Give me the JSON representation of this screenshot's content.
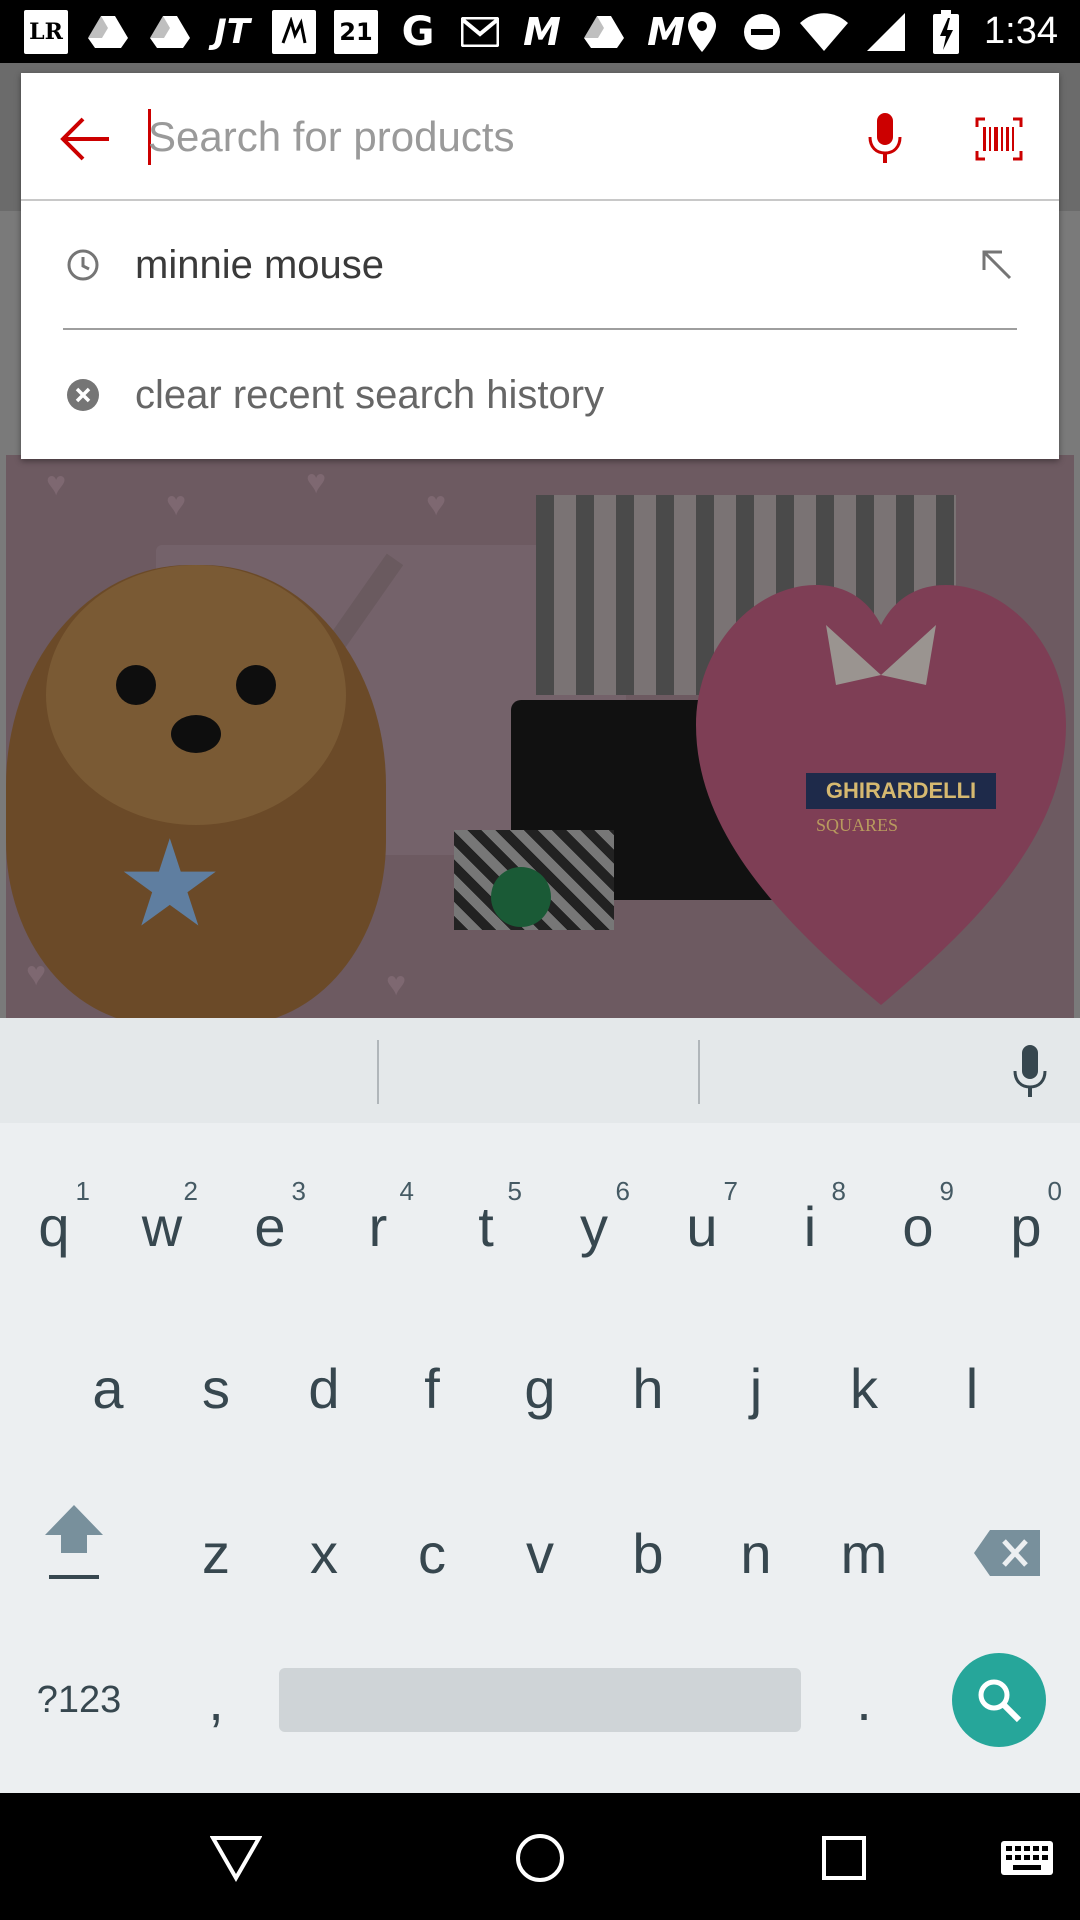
{
  "status_bar": {
    "time": "1:34",
    "icons": [
      "lr-app-icon",
      "drive-icon",
      "drive-icon",
      "jt-app-icon",
      "ny-app-icon",
      "forever21-icon",
      "google-icon",
      "gmail-icon",
      "m-app-icon",
      "drive-icon",
      "m-app-icon",
      "location-icon",
      "do-not-disturb-icon",
      "wifi-icon",
      "signal-icon",
      "battery-charging-icon"
    ],
    "lr_label": "LR",
    "jt_label": "JT",
    "f21_label": "21",
    "g_label": "G",
    "m_label": "M"
  },
  "search": {
    "placeholder": "Search for products",
    "value": "",
    "accent_color": "#cc0000"
  },
  "suggestions": {
    "recent": [
      {
        "label": "minnie mouse",
        "icon": "history-icon",
        "action_icon": "fill-query-arrow-icon"
      }
    ],
    "clear_label": "clear recent search history"
  },
  "promo": {
    "brand": "GHIRARDELLI",
    "sub": "SQUARES"
  },
  "keyboard": {
    "row1": [
      {
        "k": "q",
        "h": "1"
      },
      {
        "k": "w",
        "h": "2"
      },
      {
        "k": "e",
        "h": "3"
      },
      {
        "k": "r",
        "h": "4"
      },
      {
        "k": "t",
        "h": "5"
      },
      {
        "k": "y",
        "h": "6"
      },
      {
        "k": "u",
        "h": "7"
      },
      {
        "k": "i",
        "h": "8"
      },
      {
        "k": "o",
        "h": "9"
      },
      {
        "k": "p",
        "h": "0"
      }
    ],
    "row2": [
      "a",
      "s",
      "d",
      "f",
      "g",
      "h",
      "j",
      "k",
      "l"
    ],
    "row3": [
      "z",
      "x",
      "c",
      "v",
      "b",
      "n",
      "m"
    ],
    "symbols_label": "?123",
    "comma": ",",
    "period": ".",
    "search_key_color": "#26a69a"
  },
  "nav": {
    "buttons": [
      "back-triangle-icon",
      "home-circle-icon",
      "recents-square-icon",
      "keyboard-switch-icon"
    ]
  }
}
